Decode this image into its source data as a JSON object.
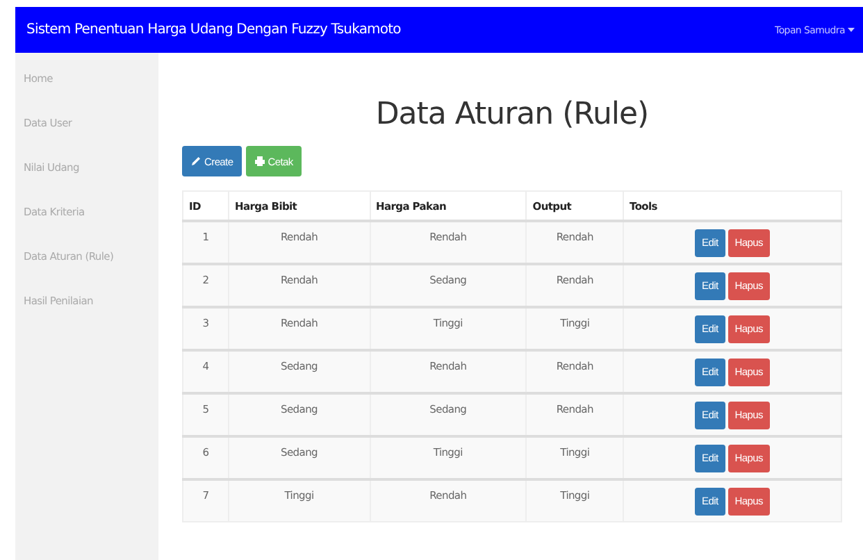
{
  "navbar": {
    "title": "Sistem Penentuan Harga Udang Dengan Fuzzy Tsukamoto",
    "user": "Topan Samudra"
  },
  "sidebar": {
    "items": [
      "Home",
      "Data User",
      "Nilai Udang",
      "Data Kriteria",
      "Data Aturan (Rule)",
      "Hasil Penilaian"
    ]
  },
  "page_title": "Data Aturan (Rule)",
  "actions": [
    {
      "label": "Create",
      "kind": "create"
    },
    {
      "label": "Cetak",
      "kind": "print"
    }
  ],
  "table": {
    "columns": [
      "ID",
      "Harga Bibit",
      "Harga Pakan",
      "Output",
      "Tools"
    ],
    "rows": [
      {
        "cells": [
          "1",
          "Rendah",
          "Rendah",
          "Rendah"
        ],
        "tools": [
          "Edit",
          "Hapus"
        ]
      },
      {
        "cells": [
          "2",
          "Rendah",
          "Sedang",
          "Rendah"
        ],
        "tools": [
          "Edit",
          "Hapus"
        ]
      },
      {
        "cells": [
          "3",
          "Rendah",
          "Tinggi",
          "Tinggi"
        ],
        "tools": [
          "Edit",
          "Hapus"
        ]
      },
      {
        "cells": [
          "4",
          "Sedang",
          "Rendah",
          "Rendah"
        ],
        "tools": [
          "Edit",
          "Hapus"
        ]
      },
      {
        "cells": [
          "5",
          "Sedang",
          "Sedang",
          "Rendah"
        ],
        "tools": [
          "Edit",
          "Hapus"
        ]
      },
      {
        "cells": [
          "6",
          "Sedang",
          "Tinggi",
          "Tinggi"
        ],
        "tools": [
          "Edit",
          "Hapus"
        ]
      },
      {
        "cells": [
          "7",
          "Tinggi",
          "Rendah",
          "Tinggi"
        ],
        "tools": [
          "Edit",
          "Hapus"
        ]
      }
    ]
  }
}
